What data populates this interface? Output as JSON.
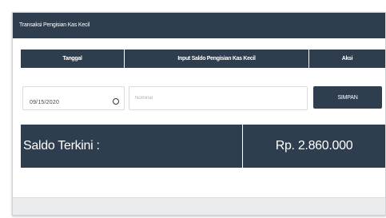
{
  "panel": {
    "title": "Transaksi Pengisian Kas Kecil"
  },
  "table": {
    "headers": {
      "date": "Tanggal",
      "input": "Input Saldo Pengisian Kas Kecil",
      "action": "Aksi"
    }
  },
  "form": {
    "date_value": "09/15/2020",
    "nominal_placeholder": "Nominal",
    "nominal_value": "",
    "save_label": "SIMPAN"
  },
  "saldo": {
    "label": "Saldo Terkini :",
    "value": "Rp. 2.860.000"
  },
  "colors": {
    "header_bg": "#2e3e4e",
    "footer_bg": "#eaecee"
  }
}
